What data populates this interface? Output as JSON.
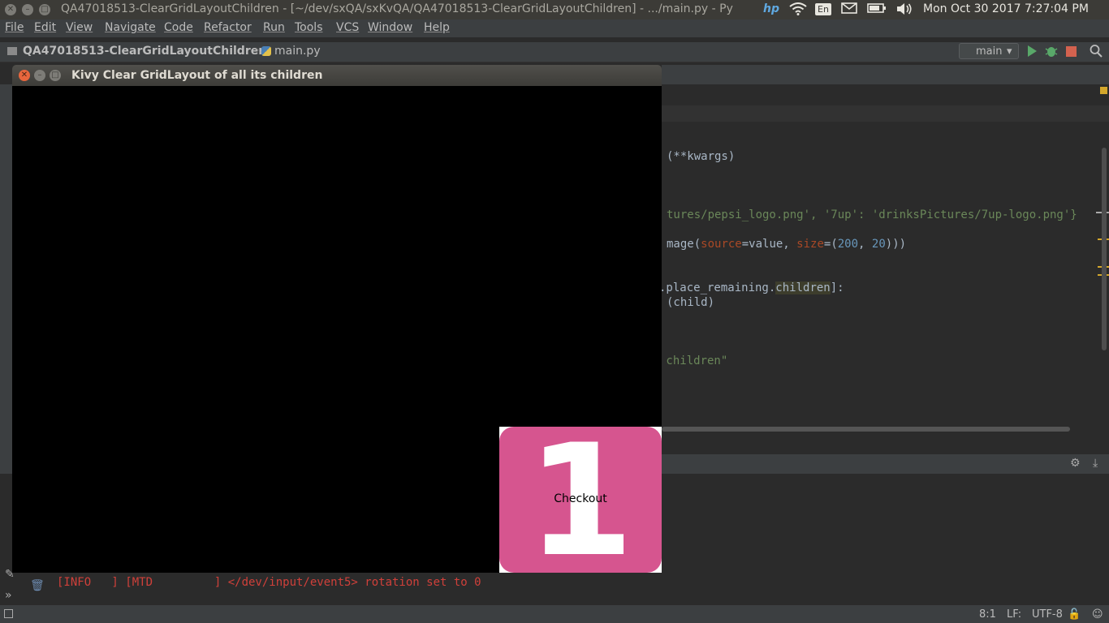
{
  "system_bar": {
    "window_title": "QA47018513-ClearGridLayoutChildren - [~/dev/sxQA/sxKvQA/QA47018513-ClearGridLayoutChildren] - .../main.py - Py",
    "hp_logo": "hp",
    "keyboard_layout": "En",
    "datetime": "Mon Oct 30 2017  7:27:04 PM"
  },
  "menubar": {
    "items": [
      "File",
      "Edit",
      "View",
      "Navigate",
      "Code",
      "Refactor",
      "Run",
      "Tools",
      "VCS",
      "Window",
      "Help"
    ]
  },
  "navbar": {
    "project": "QA47018513-ClearGridLayoutChildren",
    "file": "main.py",
    "run_config": "main"
  },
  "editor": {
    "lines": {
      "l1": "(**kwargs)",
      "l2a": "tures/pepsi_logo.png', '7up': 'drinksPictures/7up-logo.png'}",
      "l3a": "mage(",
      "l3b": "source",
      "l3c": "=value, ",
      "l3d": "size",
      "l3e": "=(",
      "l3f": "200",
      "l3g": ", ",
      "l3h": "20",
      "l3i": ")))",
      "l4a": ".place_remaining.",
      "l4b": "children",
      "l4c": "]:",
      "l5": "(child)",
      "l6": " children\""
    }
  },
  "console": {
    "line": "[INFO   ] [MTD         ] </dev/input/event5> rotation set to 0"
  },
  "statusbar": {
    "position": "8:1",
    "line_sep": "LF:",
    "encoding": "UTF-8"
  },
  "kivy_window": {
    "title": "Kivy Clear GridLayout of all its children",
    "checkout": {
      "glyph": "1",
      "label": "Checkout",
      "tile_color": "#d6558f"
    }
  }
}
